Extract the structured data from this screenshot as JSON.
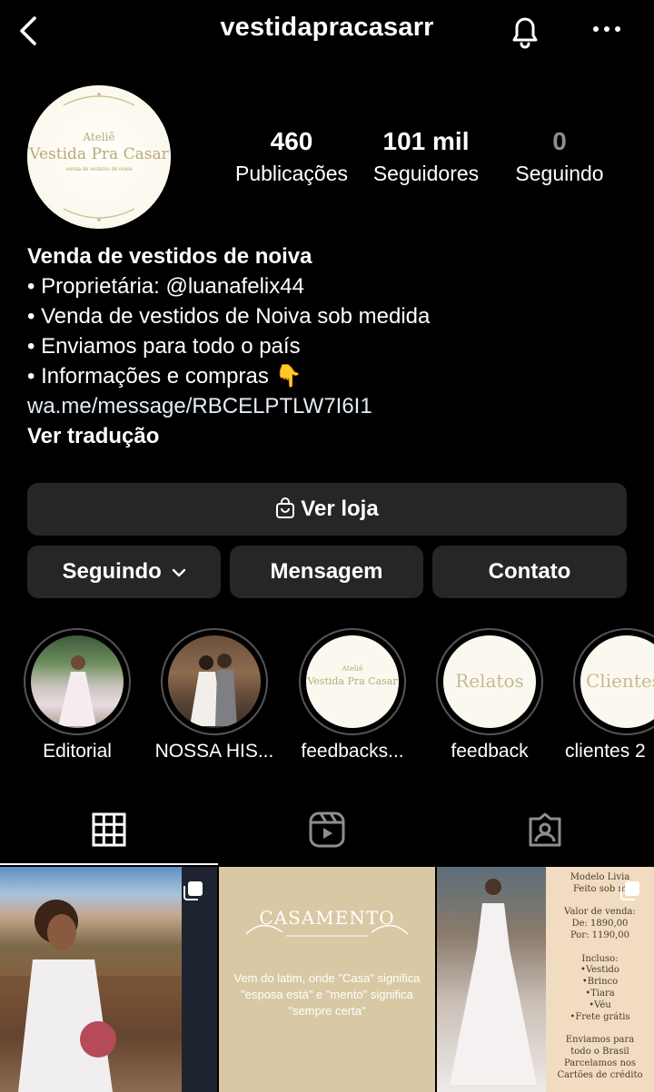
{
  "header": {
    "username": "vestidapracasarr"
  },
  "avatar": {
    "line1": "Ateliê",
    "line2": "Vestida Pra Casar",
    "line3": "venda de vestidos de noiva"
  },
  "stats": [
    {
      "value": "460",
      "label": "Publicações"
    },
    {
      "value": "101 mil",
      "label": "Seguidores"
    },
    {
      "value": "0",
      "label": "Seguindo"
    }
  ],
  "bio": {
    "name": "Venda de vestidos de noiva",
    "lines": [
      "• Proprietária: @luanafelix44",
      "• Venda de vestidos de Noiva sob medida",
      "• Enviamos para todo o país",
      "• Informações e compras 👇"
    ],
    "link": "wa.me/message/RBCELPTLW7I6I1",
    "translate": "Ver tradução"
  },
  "buttons": {
    "shop": "Ver loja",
    "following": "Seguindo",
    "message": "Mensagem",
    "contact": "Contato"
  },
  "highlights": [
    {
      "label": "Editorial"
    },
    {
      "label": "NOSSA HIS..."
    },
    {
      "label": "feedbacks...",
      "thumb_line1": "Ateliê",
      "thumb_line2": "Vestida Pra Casar"
    },
    {
      "label": "feedback",
      "thumb_text": "Relatos"
    },
    {
      "label": "clientes 2",
      "thumb_text": "Clientes"
    }
  ],
  "tabs": [
    {
      "name": "grid"
    },
    {
      "name": "reels"
    },
    {
      "name": "tagged"
    }
  ],
  "posts": {
    "post2": {
      "title": "CASAMENTO",
      "text": "Vem do latim, onde \"Casa\" significa \"esposa está\" e \"mento\" significa \"sempre certa\""
    },
    "post3": {
      "lines": [
        "Modelo Livia",
        "Feito sob m",
        "",
        "Valor de venda:",
        "De: 1890,00",
        "Por: 1190,00",
        "",
        "Incluso:",
        "•Vestido",
        "•Brinco",
        "•Tiara",
        "•Véu",
        "•Frete grátis",
        "",
        "Enviamos para",
        "todo o Brasil",
        "Parcelamos nos",
        "Cartões de crédito"
      ]
    }
  },
  "colors": {
    "background": "#000000",
    "button": "#262626",
    "cream": "#d9c8a4"
  }
}
